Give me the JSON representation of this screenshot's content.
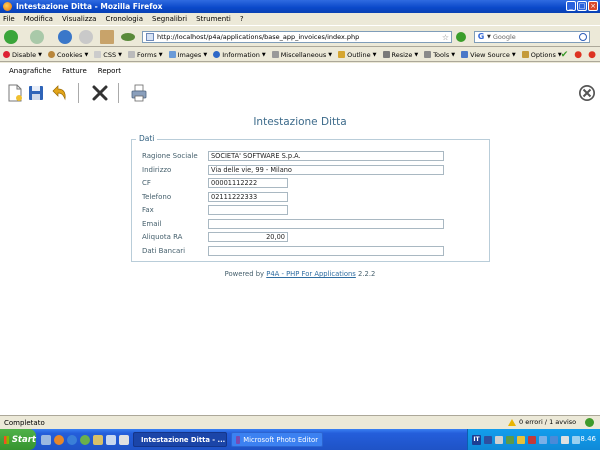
{
  "window": {
    "title": "Intestazione Ditta - Mozilla Firefox"
  },
  "menubar": [
    "File",
    "Modifica",
    "Visualizza",
    "Cronologia",
    "Segnalibri",
    "Strumenti",
    "?"
  ],
  "navbar": {
    "url": "http://localhost/p4a/applications/base_app_invoices/index.php",
    "search_placeholder": "Google"
  },
  "devbar": {
    "items": [
      "Disable",
      "Cookies",
      "CSS",
      "Forms",
      "Images",
      "Information",
      "Miscellaneous",
      "Outline",
      "Resize",
      "Tools",
      "View Source",
      "Options"
    ]
  },
  "app": {
    "menu": [
      "Anagrafiche",
      "Fatture",
      "Report"
    ],
    "page_title": "Intestazione Ditta",
    "fieldset_legend": "Dati",
    "fields": [
      {
        "label": "Ragione Sociale",
        "value": "SOCIETA' SOFTWARE S.p.A."
      },
      {
        "label": "Indirizzo",
        "value": "Via delle vie, 99 - Milano"
      },
      {
        "label": "CF",
        "value": "00001112222"
      },
      {
        "label": "Telefono",
        "value": "02111222333"
      },
      {
        "label": "Fax",
        "value": ""
      },
      {
        "label": "Email",
        "value": ""
      },
      {
        "label": "Aliquota RA",
        "value": "20,00"
      },
      {
        "label": "Dati Bancari",
        "value": ""
      }
    ],
    "powered_prefix": "Powered by",
    "powered_link": "P4A - PHP For Applications",
    "powered_version": "2.2.2"
  },
  "statusbar": {
    "text": "Completato",
    "warnings": "0 errori / 1 avviso"
  },
  "taskbar": {
    "start": "Start",
    "tasks": [
      "Intestazione Ditta - ...",
      "Microsoft Photo Editor"
    ],
    "lang": "IT",
    "clock": "8.46"
  }
}
